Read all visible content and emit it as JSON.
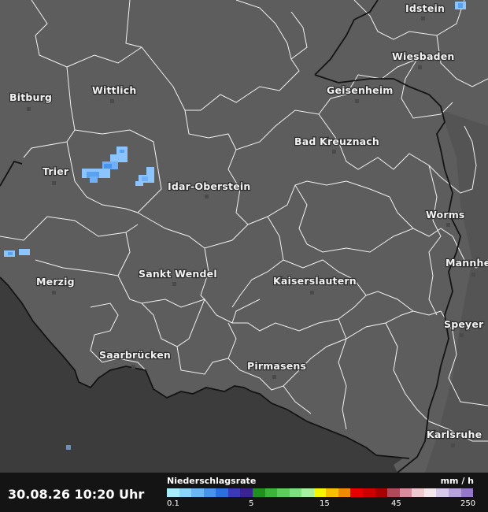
{
  "cities": [
    {
      "name": "Idstein",
      "key": "idstein"
    },
    {
      "name": "Wiesbaden",
      "key": "wiesbaden"
    },
    {
      "name": "Bitburg",
      "key": "bitburg"
    },
    {
      "name": "Wittlich",
      "key": "wittlich"
    },
    {
      "name": "Geisenheim",
      "key": "geisenheim"
    },
    {
      "name": "Bad Kreuznach",
      "key": "bad-kreuznach"
    },
    {
      "name": "Trier",
      "key": "trier"
    },
    {
      "name": "Idar-Oberstein",
      "key": "idar-oberstein"
    },
    {
      "name": "Worms",
      "key": "worms"
    },
    {
      "name": "Mannhe",
      "key": "mannheim"
    },
    {
      "name": "Merzig",
      "key": "merzig"
    },
    {
      "name": "Sankt Wendel",
      "key": "sankt-wendel"
    },
    {
      "name": "Kaiserslautern",
      "key": "kaiserslautern"
    },
    {
      "name": "Speyer",
      "key": "speyer"
    },
    {
      "name": "Saarbrücken",
      "key": "saarbruecken"
    },
    {
      "name": "Pirmasens",
      "key": "pirmasens"
    },
    {
      "name": "Karlsruhe",
      "key": "karlsruhe"
    }
  ],
  "footer": {
    "timestamp": "30.08.26 10:20 Uhr",
    "legend_title": "Niederschlagsrate",
    "legend_unit": "mm / h",
    "ticks": [
      "0.1",
      "5",
      "15",
      "45",
      "250"
    ]
  },
  "legend_colors": [
    "#a6ecfc",
    "#8cd4fa",
    "#6cb6f4",
    "#4a93ec",
    "#2e6fe0",
    "#3a3ab8",
    "#3a2390",
    "#1f8f1f",
    "#3cb43c",
    "#5ccc5c",
    "#7ee07e",
    "#a6f0a0",
    "#f5f500",
    "#f5c000",
    "#f08a00",
    "#e80000",
    "#cc0000",
    "#a80000",
    "#b04a5a",
    "#d88c9c",
    "#f0c8d0",
    "#f5e6ec",
    "#d8c8ea",
    "#b8a2dc",
    "#9678c8"
  ],
  "colors": {
    "land": "#5d5d5d",
    "outside": "#3c3c3c",
    "rain_light": "#8cc4ff",
    "rain_mid": "#5aa2f0",
    "footer_bg": "#141414"
  }
}
